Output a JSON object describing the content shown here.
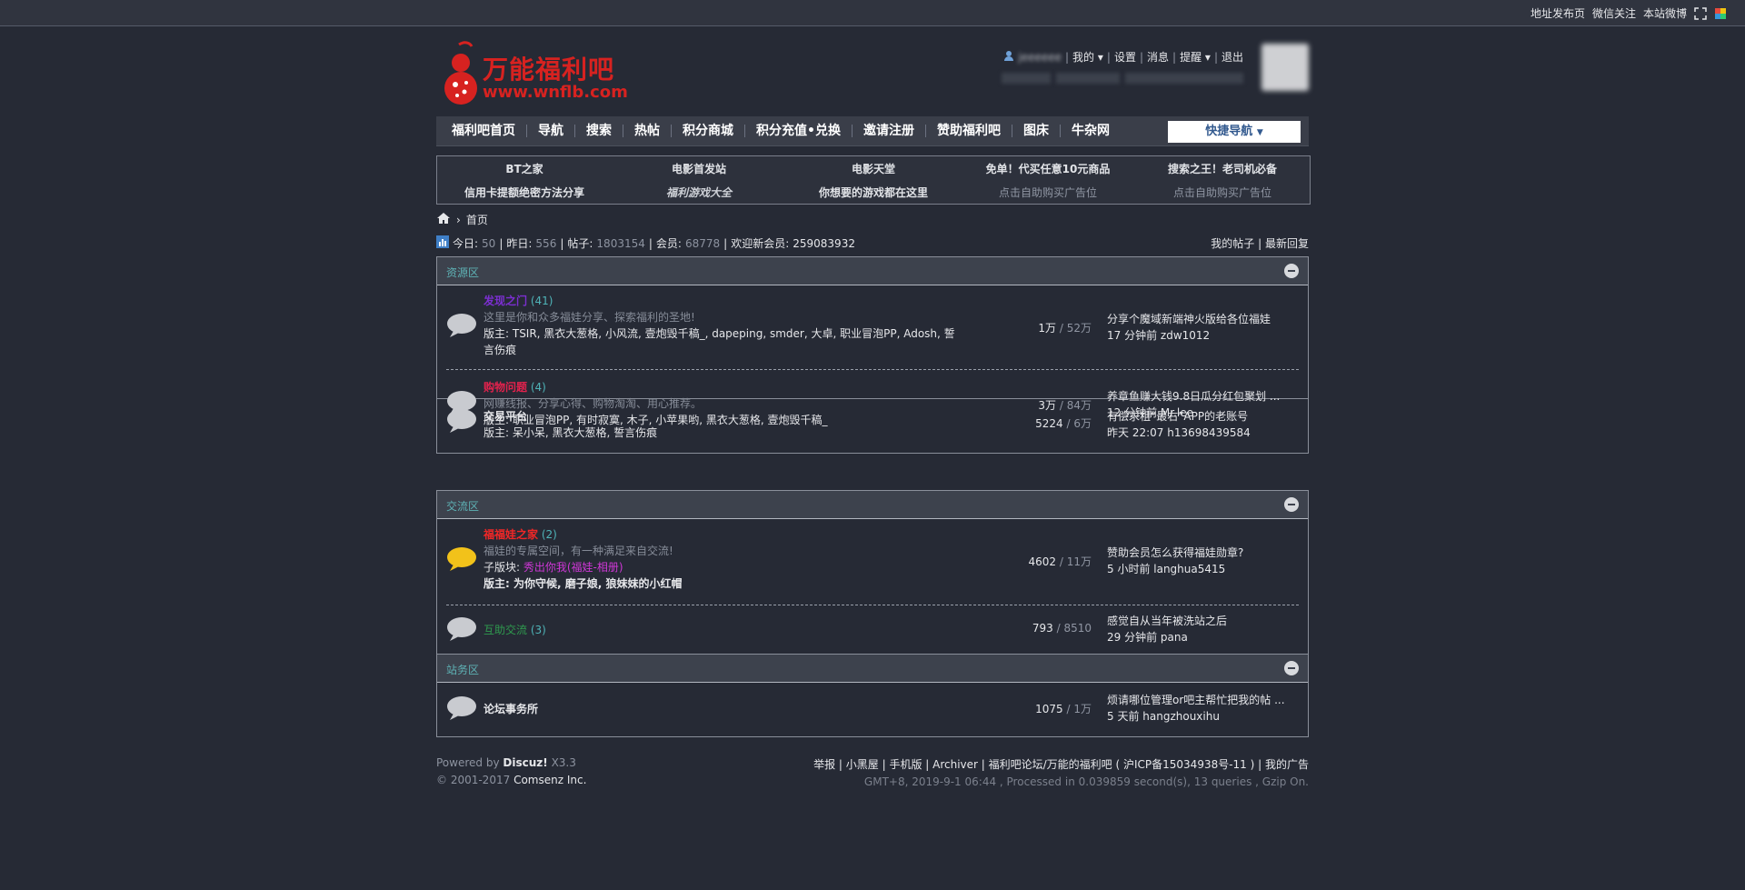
{
  "topbar": {
    "links": [
      "地址发布页",
      "微信关注",
      "本站微博"
    ]
  },
  "logo": {
    "cn": "万能福利吧",
    "url": "www.wnflb.com"
  },
  "user": {
    "items": [
      "我的",
      "设置",
      "消息",
      "提醒",
      "退出"
    ],
    "blurred_name": "jeeeeee"
  },
  "nav": {
    "items": [
      "福利吧首页",
      "导航",
      "搜索",
      "热帖",
      "积分商城",
      "积分充值•兑换",
      "邀请注册",
      "赞助福利吧",
      "图床",
      "牛杂网"
    ],
    "quick": "快捷导航"
  },
  "ads": {
    "row1": [
      "BT之家",
      "电影首发站",
      "电影天堂",
      "免单！代买任意10元商品",
      "搜索之王！老司机必备"
    ],
    "row2": [
      "信用卡提额绝密方法分享",
      "福利游戏大全",
      "你想要的游戏都在这里",
      "点击自助购买广告位",
      "点击自助购买广告位"
    ]
  },
  "breadcrumb": {
    "home": "首页"
  },
  "stats": {
    "today_label": "今日:",
    "today": "50",
    "yesterday_label": "昨日:",
    "yesterday": "556",
    "posts_label": "帖子:",
    "posts": "1803154",
    "members_label": "会员:",
    "members": "68778",
    "welcome_label": "欢迎新会员:",
    "welcome": "259083932",
    "my_posts": "我的帖子",
    "latest": "最新回复"
  },
  "sections": [
    {
      "title": "资源区",
      "forums": [
        {
          "name": "发现之门",
          "count": "(41)",
          "desc": "这里是你和众多福娃分享、探索福利的圣地!",
          "mods": "版主: TSIR, 黑衣大葱格, 小风流, 壹炮毁千稿_, dapeping, smder, 大卓, 职业冒泡PP, Adosh, 誓言伤痕",
          "threads": "1万",
          "posts": "52万",
          "last_title": "分享个魔域新端神火版给各位福娃",
          "last_meta": "17 分钟前 zdw1012"
        },
        {
          "name": "购物问题",
          "count": "(4)",
          "desc": "网赚线报、分享心得、购物淘淘、用心推荐。",
          "mods": "版主: 职业冒泡PP, 有时寂寞, 木子, 小苹果哟, 黑衣大葱格, 壹炮毁千稿_",
          "threads": "3万",
          "posts": "84万",
          "last_title": "养章鱼赚大钱9.8日瓜分红包聚划 ...",
          "last_meta": "12 分钟前 Mr.lee"
        },
        {
          "name": "交易平台",
          "count": "",
          "desc": "",
          "mods": "版主: 呆小呆, 黑衣大葱格, 誓言伤痕",
          "threads": "5224",
          "posts": "6万",
          "last_title": "有偿求租“最右”APP的老账号",
          "last_meta": "昨天 22:07 h13698439584"
        }
      ]
    },
    {
      "title": "交流区",
      "forums": [
        {
          "name": "福福娃之家",
          "count": "(2)",
          "desc": "福娃的专属空间，有一种满足来自交流!",
          "sub_label": "子版块:",
          "sub": "秀出你我(福娃-相册)",
          "mods": "版主: 为你守候, 磨子娘, 狼妹妹的小红帽",
          "threads": "4602",
          "posts": "11万",
          "last_title": "赞助会员怎么获得福娃勋章?",
          "last_meta": "5 小时前 langhua5415"
        },
        {
          "name": "互助交流",
          "count": "(3)",
          "desc": "",
          "mods": "",
          "threads": "793",
          "posts": "8510",
          "last_title": "感觉自从当年被洗站之后",
          "last_meta": "29 分钟前 pana"
        }
      ]
    },
    {
      "title": "站务区",
      "forums": [
        {
          "name": "论坛事务所",
          "count": "",
          "desc": "",
          "mods": "",
          "threads": "1075",
          "posts": "1万",
          "last_title": "烦请哪位管理or吧主帮忙把我的帖 ...",
          "last_meta": "5 天前 hangzhouxihu"
        }
      ]
    }
  ],
  "footer": {
    "powered": "Powered by",
    "discuz": "Discuz!",
    "version": "X3.3",
    "copyright": "© 2001-2017",
    "company": "Comsenz Inc.",
    "links": "举报 | 小黑屋 | 手机版 | Archiver | 福利吧论坛/万能的福利吧 ( 沪ICP备15034938号-11 ) | 我的广告",
    "info": "GMT+8, 2019-9-1 06:44 , Processed in 0.039859 second(s), 13 queries , Gzip On."
  }
}
